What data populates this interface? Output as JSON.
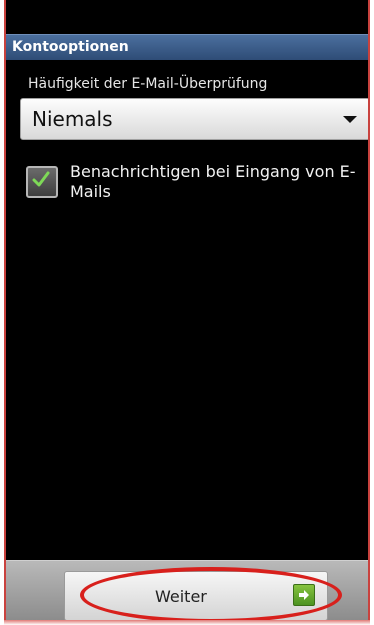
{
  "header": {
    "title": "Kontooptionen"
  },
  "settings": {
    "frequency_label": "Häufigkeit der E-Mail-Überprüfung",
    "frequency_value": "Niemals",
    "notify_label": "Benachrichtigen bei Eingang von E-Mails",
    "notify_checked": true
  },
  "footer": {
    "next_label": "Weiter"
  },
  "colors": {
    "title_bar": "#3d5f8c",
    "background": "#000000",
    "highlight": "#d8201c",
    "next_icon": "#6aab30"
  }
}
